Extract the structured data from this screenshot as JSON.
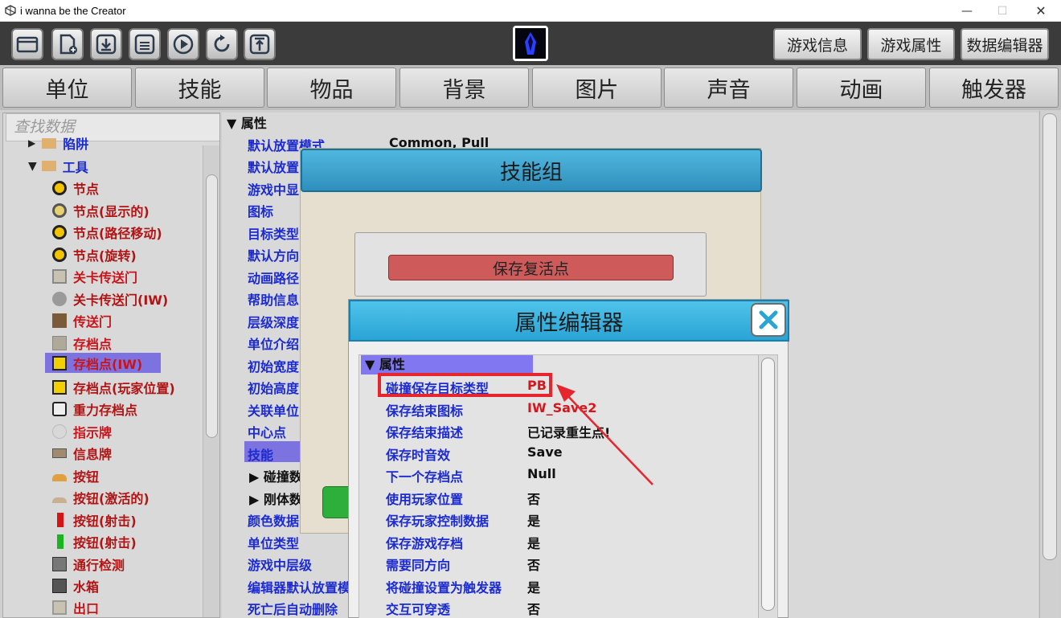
{
  "window": {
    "title": "i wanna be the Creator",
    "min": "—",
    "max": "☐",
    "close": "✕"
  },
  "toolbar": {
    "icons": [
      "folder-open-icon",
      "new-file-icon",
      "download-icon",
      "save-icon",
      "play-icon",
      "refresh-icon",
      "export-icon"
    ],
    "right_buttons": [
      "游戏信息",
      "游戏属性",
      "数据编辑器"
    ]
  },
  "tabs": [
    "单位",
    "技能",
    "物品",
    "背景",
    "图片",
    "声音",
    "动画",
    "触发器"
  ],
  "search": {
    "placeholder": "查找数据"
  },
  "tree": {
    "items": [
      {
        "label": "陷阱",
        "color": "blue"
      },
      {
        "label": "工具",
        "color": "blue"
      },
      {
        "label": "节点",
        "color": "dark"
      },
      {
        "label": "节点(显示的)",
        "color": "dark"
      },
      {
        "label": "节点(路径移动)",
        "color": "dark"
      },
      {
        "label": "节点(旋转)",
        "color": "dark"
      },
      {
        "label": "关卡传送门",
        "color": "red"
      },
      {
        "label": "关卡传送门(IW)",
        "color": "dark"
      },
      {
        "label": "传送门",
        "color": "red"
      },
      {
        "label": "存档点",
        "color": "red"
      },
      {
        "label": "存档点(IW)",
        "color": "red"
      },
      {
        "label": "存档点(玩家位置)",
        "color": "dark"
      },
      {
        "label": "重力存档点",
        "color": "dark"
      },
      {
        "label": "指示牌",
        "color": "red"
      },
      {
        "label": "信息牌",
        "color": "dark"
      },
      {
        "label": "按钮",
        "color": "dark"
      },
      {
        "label": "按钮(激活的)",
        "color": "dark"
      },
      {
        "label": "按钮(射击)",
        "color": "dark"
      },
      {
        "label": "按钮(射击)",
        "color": "dark"
      },
      {
        "label": "通行检测",
        "color": "dark"
      },
      {
        "label": "水箱",
        "color": "dark"
      },
      {
        "label": "出口",
        "color": "red"
      }
    ]
  },
  "properties": {
    "header": "▼ 属性",
    "rows": [
      {
        "key": "默认放置模式",
        "value": "Common, Pull"
      },
      {
        "key": "默认放置",
        "value": ""
      },
      {
        "key": "游戏中显",
        "value": ""
      },
      {
        "key": "图标",
        "value": ""
      },
      {
        "key": "目标类型",
        "value": ""
      },
      {
        "key": "默认方向",
        "value": ""
      },
      {
        "key": "动画路径",
        "value": ""
      },
      {
        "key": "帮助信息",
        "value": ""
      },
      {
        "key": "层级深度",
        "value": ""
      },
      {
        "key": "单位介绍",
        "value": ""
      },
      {
        "key": "初始宽度",
        "value": ""
      },
      {
        "key": "初始高度",
        "value": ""
      },
      {
        "key": "关联单位",
        "value": ""
      },
      {
        "key": "中心点",
        "value": ""
      },
      {
        "key": "技能",
        "value": ""
      },
      {
        "key": "▶ 碰撞数",
        "value": ""
      },
      {
        "key": "▶ 刚体数",
        "value": ""
      },
      {
        "key": "颜色数据",
        "value": ""
      },
      {
        "key": "单位类型",
        "value": ""
      },
      {
        "key": "游戏中层级",
        "value": ""
      },
      {
        "key": "编辑器默认放置模",
        "value": ""
      },
      {
        "key": "死亡后自动删除",
        "value": ""
      }
    ]
  },
  "skill_group_dialog": {
    "title": "技能组",
    "item": "保存复活点"
  },
  "prop_editor": {
    "title": "属性编辑器",
    "header": "▼ 属性",
    "rows": [
      {
        "key": "碰撞保存目标类型",
        "value": "PB"
      },
      {
        "key": "保存结束图标",
        "value": "IW_Save2"
      },
      {
        "key": "保存结束描述",
        "value": "已记录重生点!"
      },
      {
        "key": "保存时音效",
        "value": "Save"
      },
      {
        "key": "下一个存档点",
        "value": "Null"
      },
      {
        "key": "使用玩家位置",
        "value": "否"
      },
      {
        "key": "保存玩家控制数据",
        "value": "是"
      },
      {
        "key": "保存游戏存档",
        "value": "是"
      },
      {
        "key": "需要同方向",
        "value": "否"
      },
      {
        "key": "将碰撞设置为触发器",
        "value": "是"
      },
      {
        "key": "交互可穿透",
        "value": "否"
      }
    ]
  },
  "colors": {
    "accent": "#2aa4d6",
    "selection": "#7d73e0",
    "highlight": "#e5262e"
  }
}
